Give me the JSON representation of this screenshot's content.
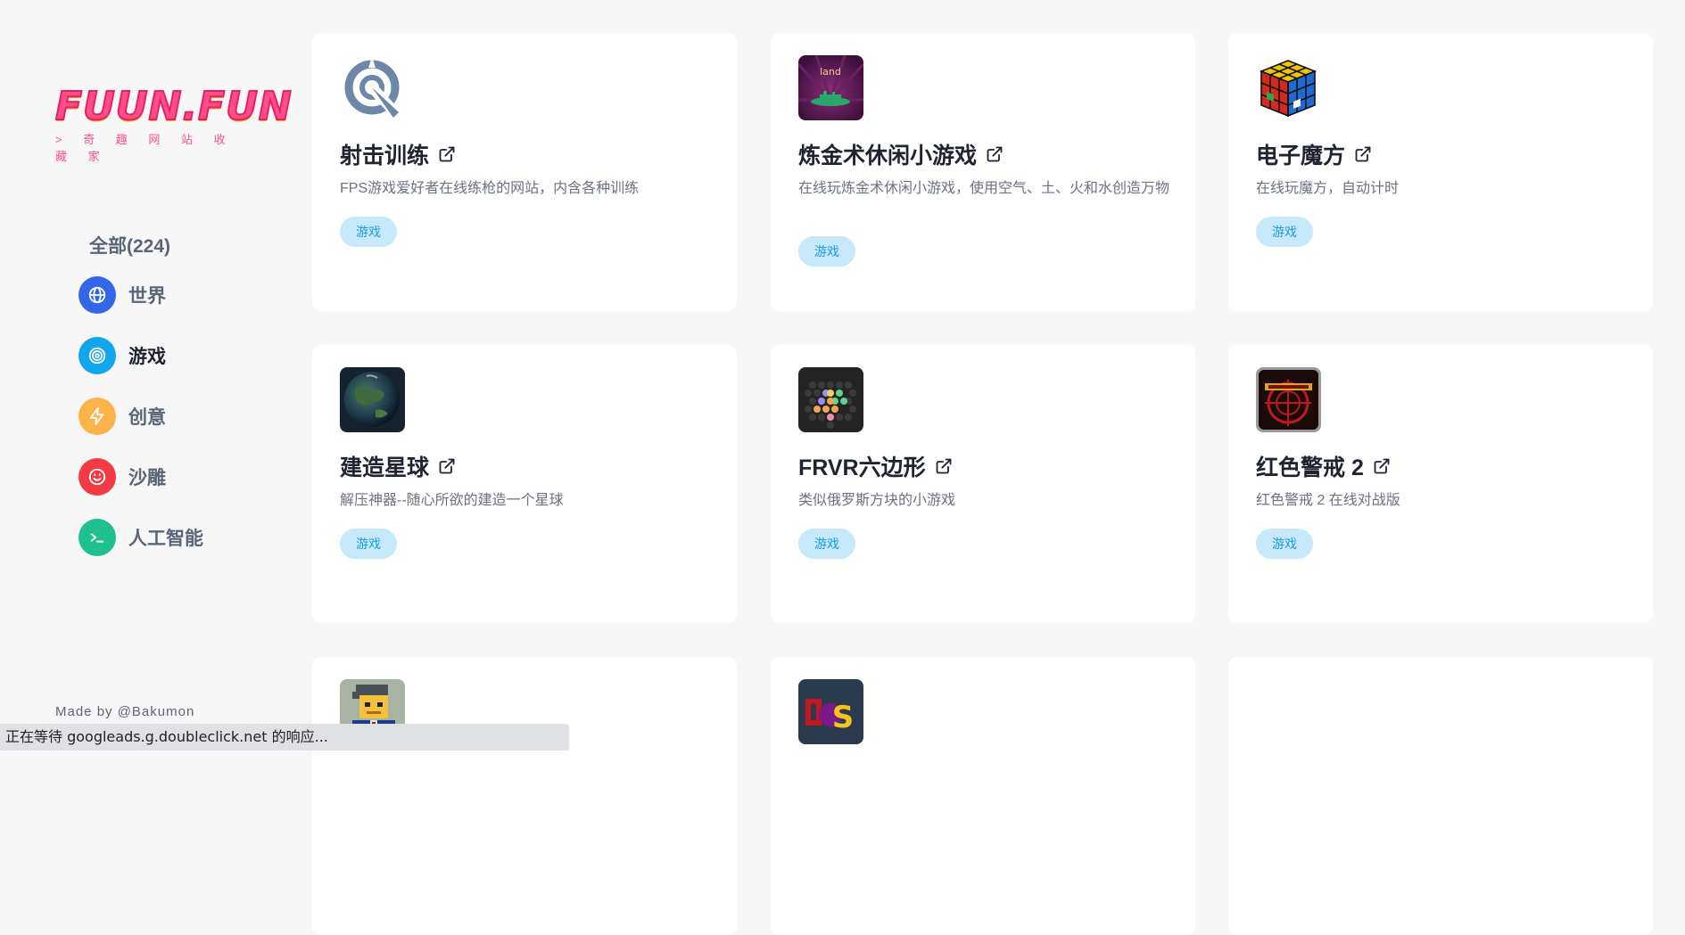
{
  "sidebar": {
    "logo_text": "FUUN.FUN",
    "logo_subtitle": "> 奇 趣 网 站 收 藏 家",
    "all_label": "全部(224)",
    "items": [
      {
        "label": "世界",
        "color": "#3367e8",
        "icon": "globe-icon"
      },
      {
        "label": "游戏",
        "color": "#12a6ec",
        "icon": "target-icon"
      },
      {
        "label": "创意",
        "color": "#fcb347",
        "icon": "lightning-icon"
      },
      {
        "label": "沙雕",
        "color": "#f23b45",
        "icon": "smiley-icon"
      },
      {
        "label": "人工智能",
        "color": "#1fbf8f",
        "icon": "terminal-icon"
      }
    ],
    "made_by": "Made by @Bakumon"
  },
  "cards": [
    {
      "title": "射击训练",
      "desc": "FPS游戏爱好者在线练枪的网站，内含各种训练",
      "tag": "游戏",
      "icon": "crosshair-icon"
    },
    {
      "title": "炼金术休闲小游戏",
      "desc": "在线玩炼金术休闲小游戏，使用空气、土、火和水创造万物",
      "tag": "游戏",
      "icon": "alchemy-land-icon",
      "icon_text": "land"
    },
    {
      "title": "电子魔方",
      "desc": "在线玩魔方，自动计时",
      "tag": "游戏",
      "icon": "rubiks-cube-icon"
    },
    {
      "title": "建造星球",
      "desc": "解压神器--随心所欲的建造一个星球",
      "tag": "游戏",
      "icon": "planet-icon"
    },
    {
      "title": "FRVR六边形",
      "desc": "类似俄罗斯方块的小游戏",
      "tag": "游戏",
      "icon": "hexagon-grid-icon"
    },
    {
      "title": "红色警戒 2",
      "desc": "红色警戒 2 在线对战版",
      "tag": "游戏",
      "icon": "red-alert-icon"
    },
    {
      "title": "",
      "desc": "",
      "tag": "",
      "icon": "pixel-man-icon"
    },
    {
      "title": "",
      "desc": "",
      "tag": "",
      "icon": "dos-logo-icon",
      "icon_text": "DS"
    },
    {
      "title": "",
      "desc": "",
      "tag": "",
      "icon": ""
    }
  ],
  "status_bar": "正在等待 googleads.g.doubleclick.net 的响应..."
}
